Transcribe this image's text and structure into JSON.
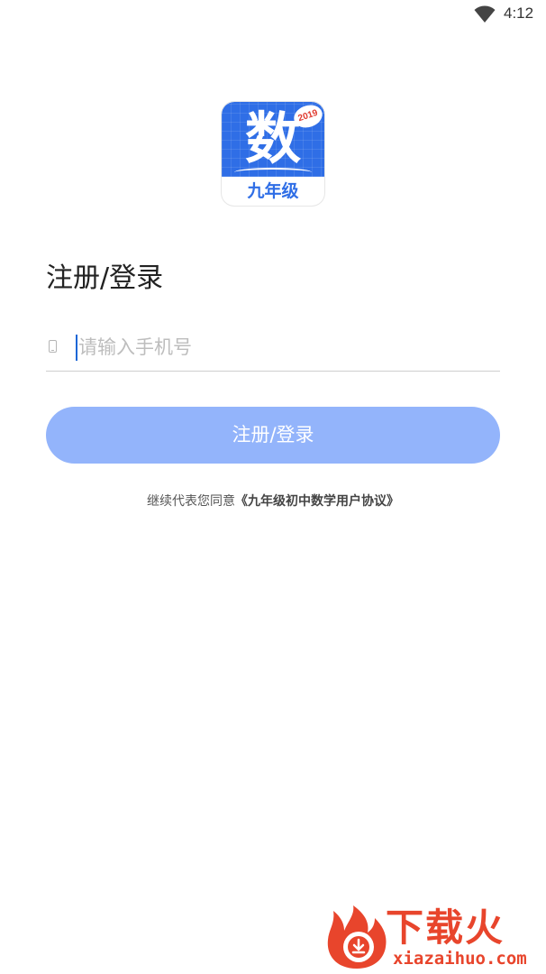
{
  "status_bar": {
    "time": "4:12",
    "wifi_icon": "wifi-icon"
  },
  "logo": {
    "main_char": "数",
    "badge": "2019",
    "grade": "九年级",
    "color": "#2f6ee6"
  },
  "login": {
    "title": "注册/登录",
    "phone_placeholder": "请输入手机号",
    "phone_value": "",
    "phone_icon": "mobile-phone-icon",
    "button_label": "注册/登录",
    "button_color": "#93b4fb"
  },
  "agreement": {
    "prefix": "继续代表您同意",
    "link": "《九年级初中数学用户协议》"
  },
  "watermark": {
    "brand": "下载火",
    "url": "xiazaihuo.com",
    "color": "#e8452c"
  }
}
